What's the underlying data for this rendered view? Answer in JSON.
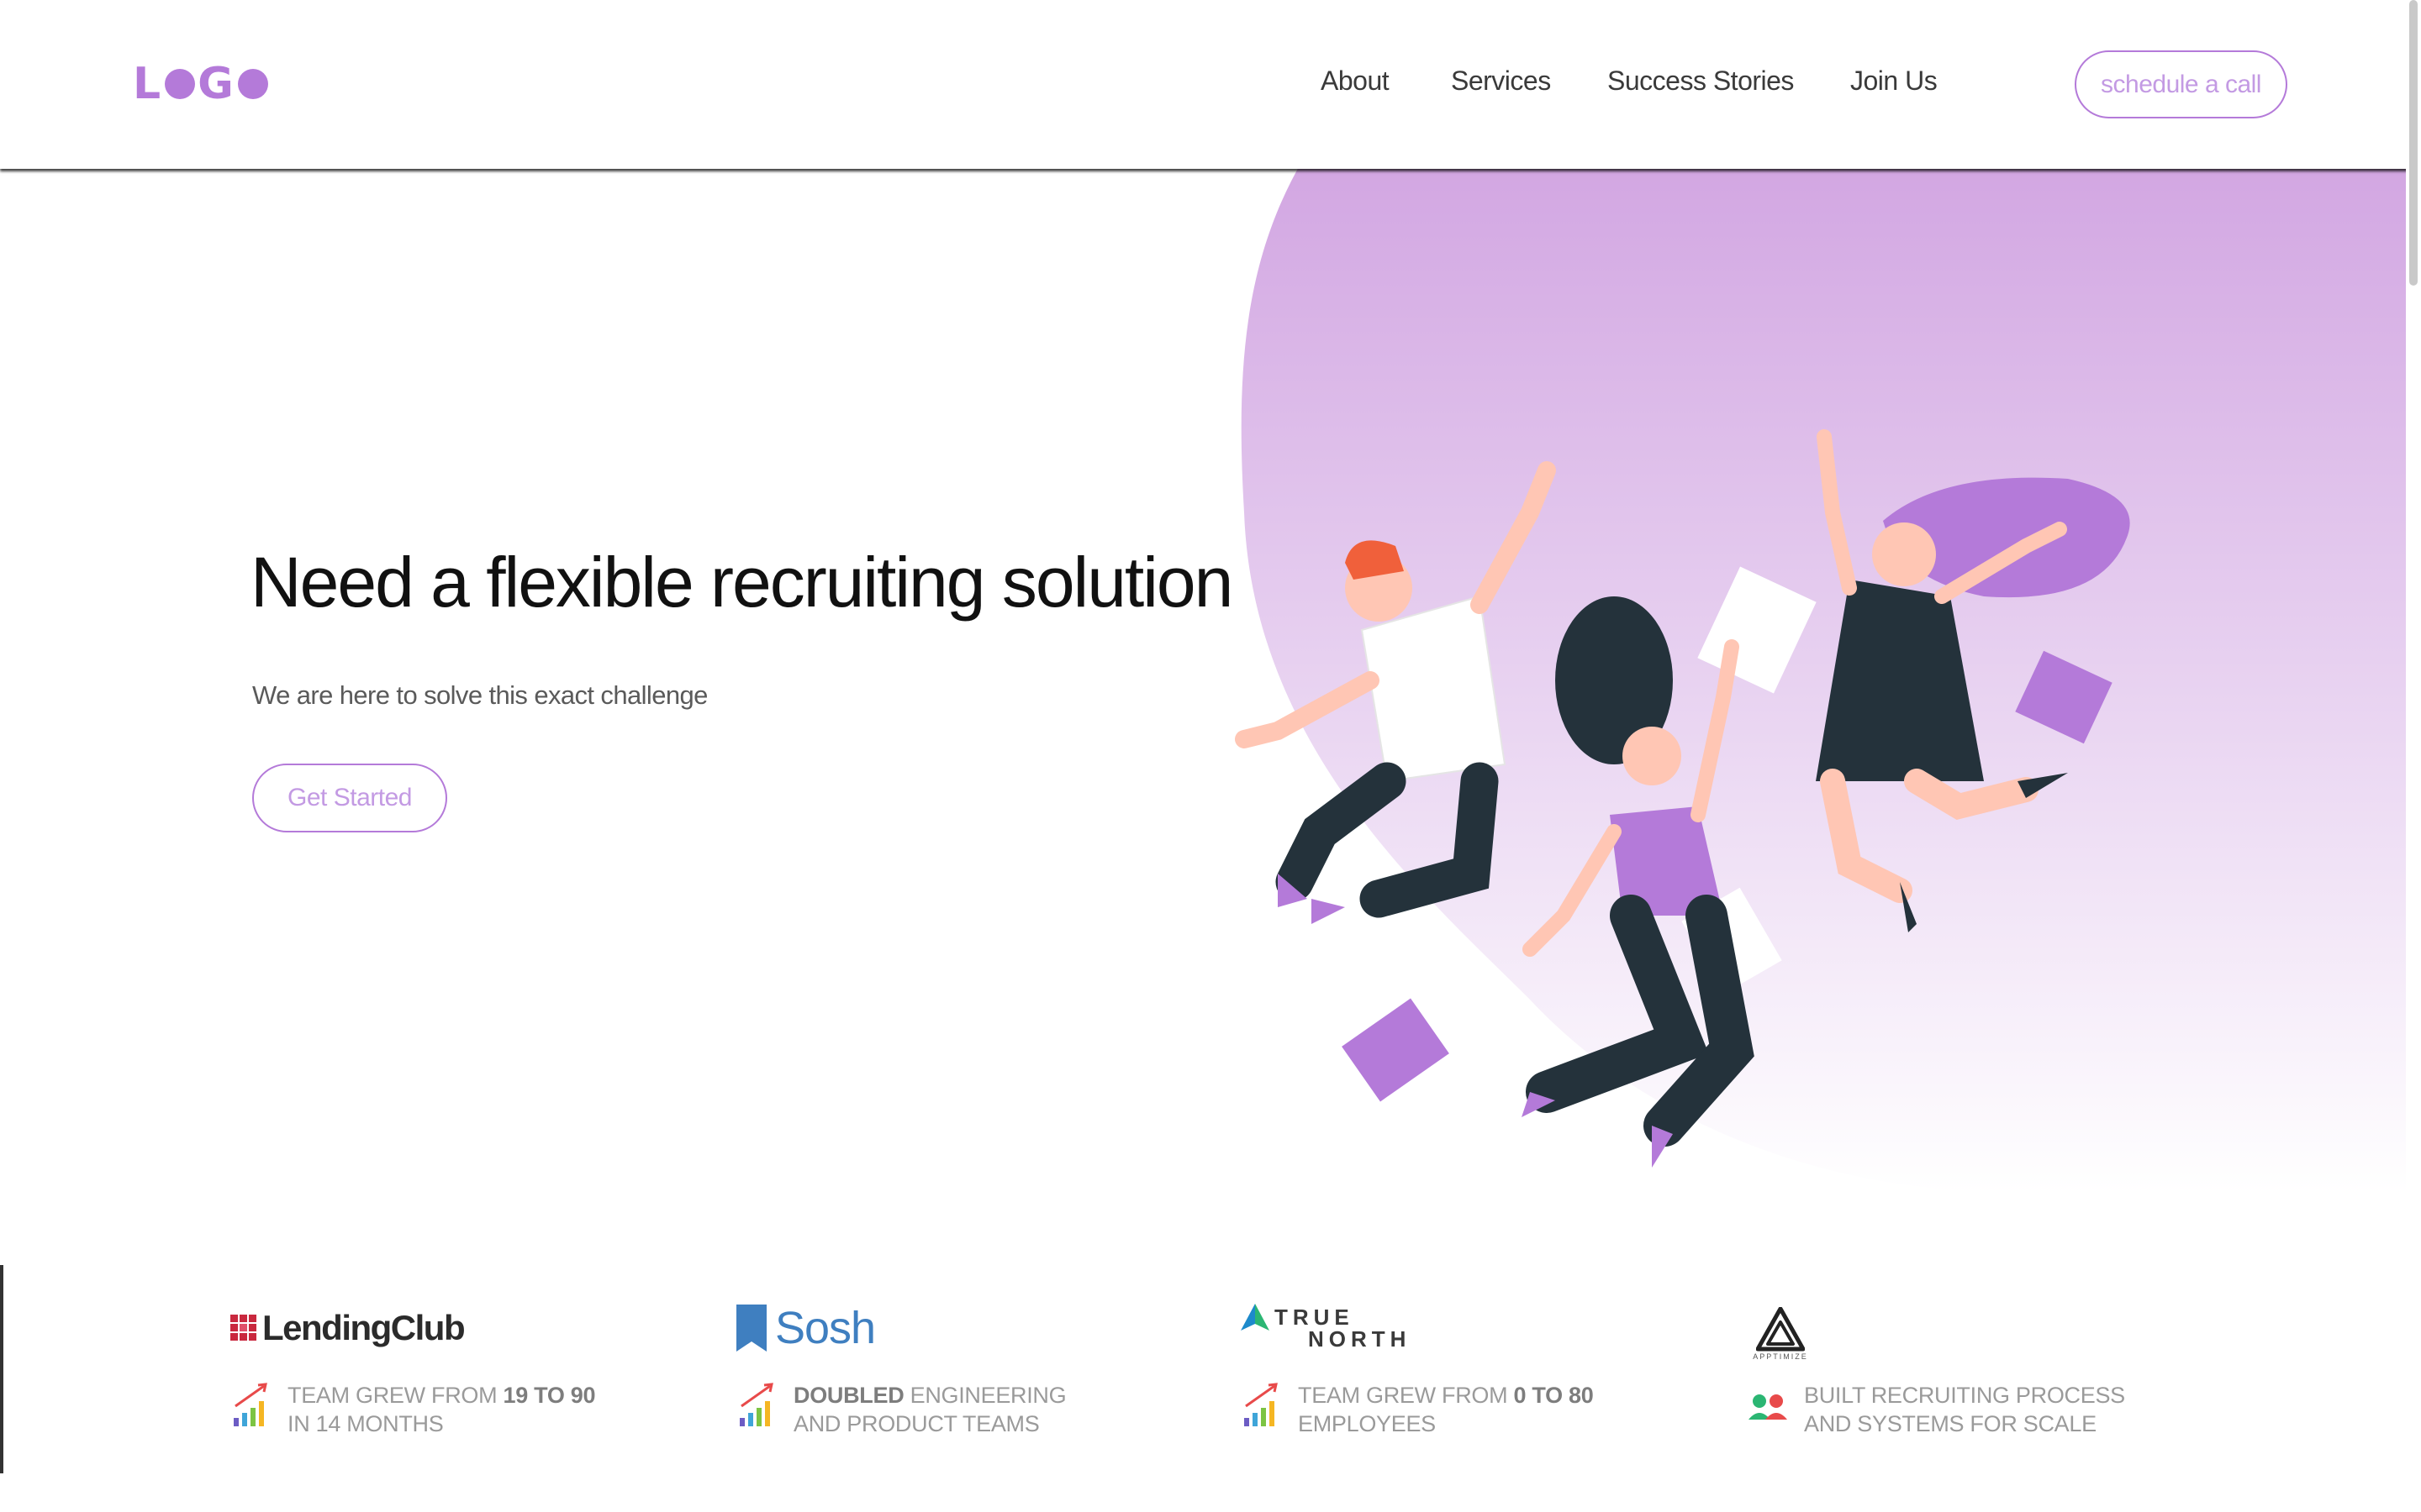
{
  "header": {
    "logo_text": "LOGO",
    "nav": [
      "About",
      "Services",
      "Success Stories",
      "Join Us"
    ],
    "cta_label": "schedule a call"
  },
  "hero": {
    "title": "Need a flexible recruiting solution",
    "subtitle": "We are here to solve this exact challenge",
    "button_label": "Get Started"
  },
  "stats": [
    {
      "company": "LendingClub",
      "line1_pre": "TEAM GREW FROM ",
      "line1_bold": "19 TO 90",
      "line1_post": "",
      "line2": "IN 14 MONTHS",
      "icon": "growth-chart-icon"
    },
    {
      "company": "Sosh",
      "line1_pre": "",
      "line1_bold": "DOUBLED",
      "line1_post": " ENGINEERING",
      "line2": "AND PRODUCT TEAMS",
      "icon": "growth-chart-icon"
    },
    {
      "company_line1": "TRUE",
      "company_line2": "NORTH",
      "line1_pre": "TEAM GREW FROM ",
      "line1_bold": "0 TO 80",
      "line1_post": "",
      "line2": "EMPLOYEES",
      "icon": "growth-chart-icon"
    },
    {
      "company": "APPTIMIZE",
      "line1_pre": "BUILT RECRUITING PROCESS",
      "line1_bold": "",
      "line1_post": "",
      "line2": "AND SYSTEMS FOR SCALE",
      "icon": "team-icon"
    }
  ],
  "colors": {
    "accent": "#b47ad9",
    "accent_light": "#c39ae3",
    "blob_top": "#d2a6e2",
    "text_dark": "#111111",
    "text_muted": "#9a9a9a"
  }
}
